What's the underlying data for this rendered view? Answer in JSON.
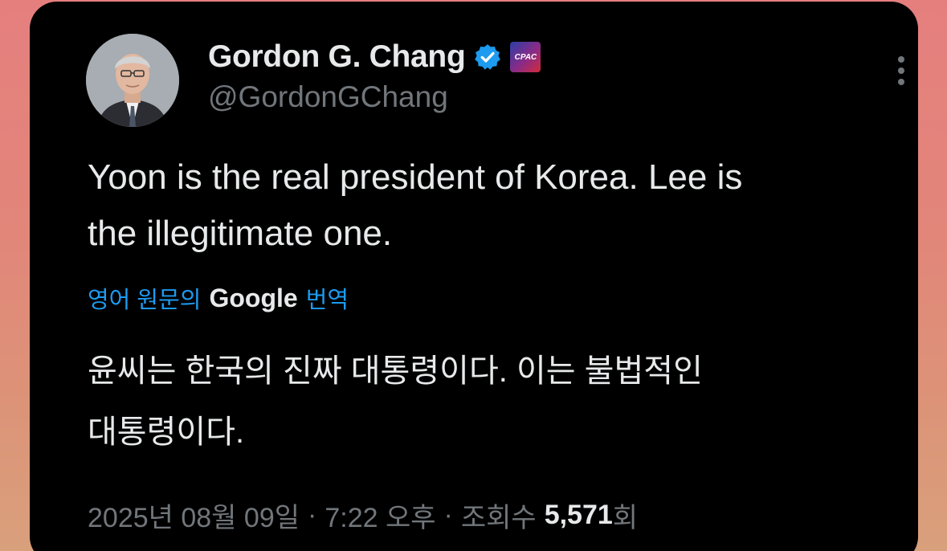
{
  "tweet": {
    "author": {
      "display_name": "Gordon G. Chang",
      "handle": "@GordonGChang",
      "verified": true,
      "verified_icon": "verified-badge-icon",
      "affiliate_icon": "affiliate-org-badge-icon",
      "affiliate_badge_text": "CPAC",
      "avatar_icon": "profile-avatar"
    },
    "menu_icon": "more-options-icon",
    "text_lines": [
      "Yoon is the real president of Korea. Lee is",
      "the illegitimate one."
    ],
    "translation": {
      "prefix": "영어 원문의",
      "provider": "Google",
      "suffix": "번역",
      "text_lines": [
        "윤씨는 한국의 진짜 대통령이다. 이는 불법적인",
        "대통령이다."
      ]
    },
    "meta": {
      "date": "2025년 08월 09일",
      "time": "7:22 오후",
      "views_label": "조회수",
      "views_count": "5,571",
      "views_suffix": "회"
    }
  },
  "colors": {
    "card_background": "#000000",
    "primary_text": "#e7e9ea",
    "secondary_text": "#71767b",
    "link_blue": "#1d9bf0",
    "verified_blue": "#1d9bf0"
  }
}
